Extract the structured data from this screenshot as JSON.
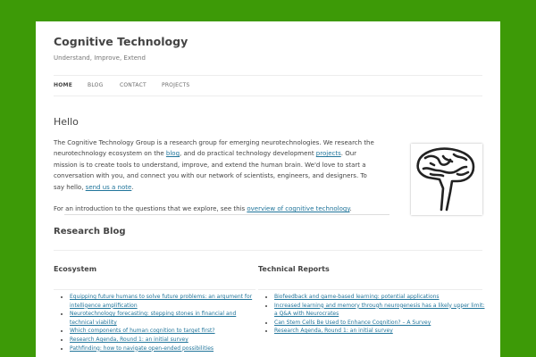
{
  "site": {
    "title": "Cognitive Technology",
    "tagline": "Understand, Improve, Extend"
  },
  "nav": {
    "items": [
      {
        "label": "HOME",
        "active": true
      },
      {
        "label": "BLOG"
      },
      {
        "label": "CONTACT"
      },
      {
        "label": "PROJECTS"
      }
    ]
  },
  "hello": {
    "title": "Hello",
    "p1": {
      "t1": "The Cognitive Technology Group is a research group for emerging neurotechnologies. We research the neurotechnology ecosystem on the ",
      "l1": "blog",
      "t2": ", and do practical technology development ",
      "l2": "projects",
      "t3": ". Our mission is to create tools to understand, improve, and extend the human brain. We'd love to start a conversation with you, and connect you with our network of scientists, engineers, and designers. To say hello, ",
      "l3": "send us a note",
      "t4": "."
    },
    "p2": {
      "t1": "For an introduction to the questions that we explore, see this ",
      "l1": "overview of cognitive technology",
      "t2": "."
    },
    "image_icon": "brain-head-icon"
  },
  "blog": {
    "title": "Research Blog",
    "columns": [
      {
        "title": "Ecosystem",
        "items": [
          "Equipping future humans to solve future problems: an argument for intelligence amplification",
          "Neurotechnology forecasting: stepping stones in financial and technical viability",
          "Which components of human cognition to target first?",
          "Research Agenda, Round 1: an initial survey",
          "Pathfinding: how to navigate open-ended possibilities"
        ]
      },
      {
        "title": "Technical Reports",
        "items": [
          "Biofeedback and game-based learning: potential applications",
          "Increased learning and memory through neurogenesis has a likely upper limit: a Q&A with Neurocrates",
          "Can Stem Cells Be Used to Enhance Cognition? – A Survey",
          "Research Agenda, Round 1: an initial survey"
        ]
      }
    ]
  },
  "colors": {
    "background": "#3d9a07",
    "link": "#21759b",
    "text": "#444444"
  }
}
